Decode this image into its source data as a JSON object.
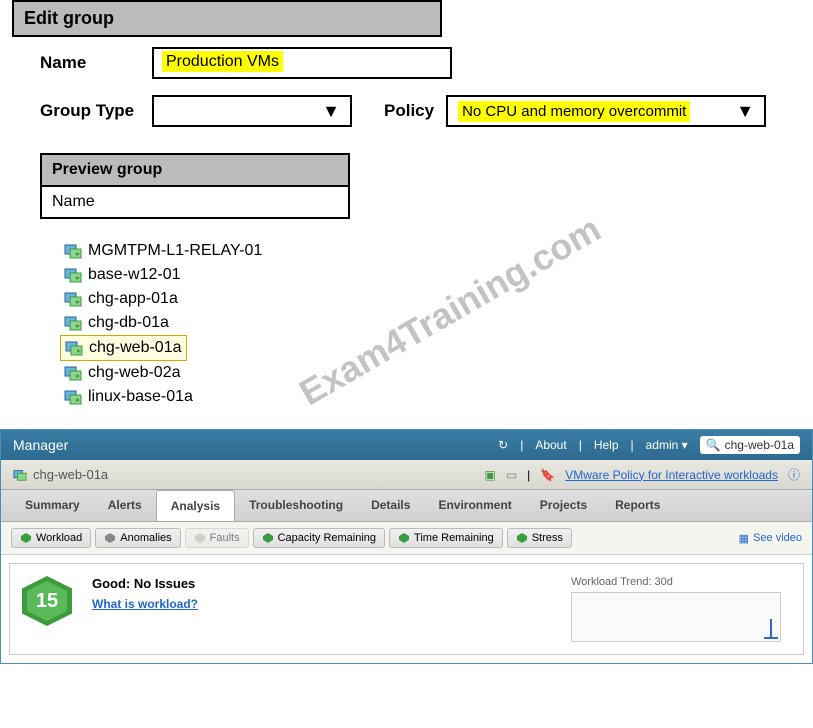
{
  "edit_group": {
    "header": "Edit group",
    "name_label": "Name",
    "name_value": "Production VMs",
    "group_type_label": "Group Type",
    "group_type_value": "",
    "policy_label": "Policy",
    "policy_value": "No CPU and memory overcommit"
  },
  "preview": {
    "header": "Preview group",
    "column": "Name"
  },
  "vm_list": [
    {
      "name": "MGMTPM-L1-RELAY-01",
      "highlighted": false
    },
    {
      "name": "base-w12-01",
      "highlighted": false
    },
    {
      "name": "chg-app-01a",
      "highlighted": false
    },
    {
      "name": "chg-db-01a",
      "highlighted": false
    },
    {
      "name": "chg-web-01a",
      "highlighted": true
    },
    {
      "name": "chg-web-02a",
      "highlighted": false
    },
    {
      "name": "linux-base-01a",
      "highlighted": false
    }
  ],
  "watermark": "Exam4Training.com",
  "manager": {
    "title": "Manager",
    "about": "About",
    "help": "Help",
    "admin": "admin",
    "search_value": "chg-web-01a"
  },
  "object_bar": {
    "name": "chg-web-01a",
    "policy_link": "VMware Policy for Interactive workloads"
  },
  "tabs": [
    {
      "label": "Summary",
      "active": false
    },
    {
      "label": "Alerts",
      "active": false
    },
    {
      "label": "Analysis",
      "active": true
    },
    {
      "label": "Troubleshooting",
      "active": false
    },
    {
      "label": "Details",
      "active": false
    },
    {
      "label": "Environment",
      "active": false
    },
    {
      "label": "Projects",
      "active": false
    },
    {
      "label": "Reports",
      "active": false
    }
  ],
  "subtabs": [
    {
      "label": "Workload",
      "icon": "workload",
      "color": "#3a9c3a"
    },
    {
      "label": "Anomalies",
      "icon": "anomalies",
      "color": "#888"
    },
    {
      "label": "Faults",
      "icon": "faults",
      "color": "#aaa",
      "disabled": true
    },
    {
      "label": "Capacity Remaining",
      "icon": "capacity",
      "color": "#3a9c3a"
    },
    {
      "label": "Time Remaining",
      "icon": "time",
      "color": "#3a9c3a"
    },
    {
      "label": "Stress",
      "icon": "stress",
      "color": "#3a9c3a"
    }
  ],
  "see_video": "See video",
  "health": {
    "score": "15",
    "status": "Good: No Issues",
    "link": "What is workload?"
  },
  "trend": {
    "label": "Workload Trend: 30d"
  },
  "chart_data": {
    "type": "line",
    "title": "Workload Trend: 30d",
    "xlabel": "",
    "ylabel": "",
    "x": [
      0,
      30
    ],
    "values": [
      0,
      0
    ],
    "note": "Sparse sparkline showing minimal workload activity near end of 30 day window"
  }
}
